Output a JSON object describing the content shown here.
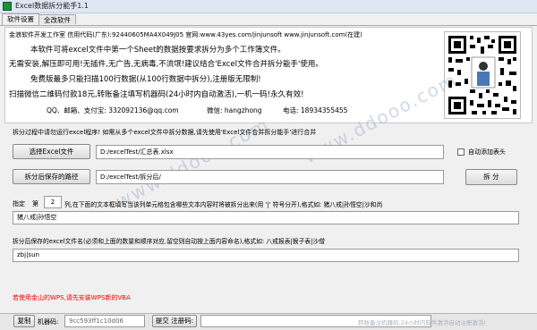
{
  "window": {
    "title": "Excel数据拆分能手1.1"
  },
  "tabs": [
    {
      "label": "软件设置"
    },
    {
      "label": "全改软件"
    }
  ],
  "info": {
    "line1": "金浪软件开发工作室  信用代码(广东):92440605MA4X049J05 官网:www.43yes.com/jinjunsoft  www.jinjunsoft.com(在建)",
    "line2": "本软件可将excel文件中第一个Sheet的数据按要求拆分为多个工作簿文件。",
    "line3": "无需安装,解压即可用!无插件,无广告,无病毒,不流氓!建议结合'Excel文件合并拆分能手'使用。",
    "line4": "免费版最多只能扫描100行数据(从100行数据中拆分),注册版无限制!",
    "line5": "扫描微信二维码付款18元,转账备注填写机器码(24小时内自动激活),一机一码!永久有效!",
    "line6_qq": "QQ、邮箱、支付宝: 332092136@qq.com",
    "line6_wechat": "微信: hangzhong",
    "line6_phone": "电话: 18934355455"
  },
  "notice": "拆分过程中请勿运行excel程序! 如需从多个excel文件中拆分数据,请先使用'Excel文件合并拆分能手'进行合并",
  "select_file": {
    "button": "选择Excel文件",
    "value": "D:/excelTest/汇总表.xlsx"
  },
  "auto_header": {
    "label": "自动添加表头",
    "checked": false
  },
  "save_path": {
    "button": "拆分后保存的路径",
    "value": "D:/excelTest/拆分后/"
  },
  "split_button": "拆 分",
  "column_spec": {
    "prefix": "指定",
    "di": "第",
    "column_number": "2",
    "suffix": "列,在下面的文本框填写当该列单元格包含哪些文本内容时将被拆分出来(用 '|' 符号分开),格式如: 猪八戒|孙悟空|沙和尚",
    "value": "猪八戒|孙悟空"
  },
  "filename_spec": {
    "label": "拆分后保存的excel文件名(必须和上面的数量和顺序对应,留空则自动按上面内容命名),格式如: 八戒报表|猴子表|沙僧",
    "value": "zbj|sun"
  },
  "warning": "若使用金山的WPS,请先安装WPS新的VBA",
  "status": {
    "copy_button": "复制",
    "machine_label": "机器码:",
    "machine_code": "9cc593ff1c10d06",
    "submit_button": "提交 注册码:",
    "register_code": "",
    "hint": "转账备注机器码,24小时内软件激活自动注册激活!"
  },
  "colors": {
    "accent_red": "#e00000",
    "title_bg": "#dfe7f3"
  }
}
